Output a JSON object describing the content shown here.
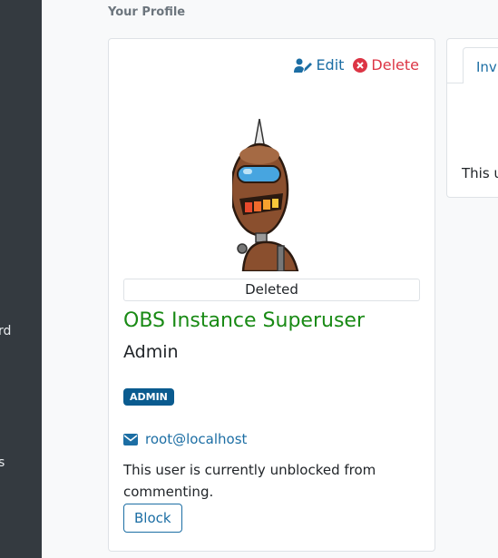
{
  "sidebar": {
    "text_top": "rd",
    "text_bottom": "s"
  },
  "breadcrumb": "Your Profile",
  "profile": {
    "edit_label": "Edit",
    "delete_label": "Delete",
    "status": "Deleted",
    "realname": "OBS Instance Superuser",
    "login": "Admin",
    "badge": "ADMIN",
    "email": "root@localhost",
    "block_text": "This user is currently unblocked from commenting.",
    "block_button": "Block"
  },
  "side_card": {
    "tab_label": "Inv",
    "text": "This u"
  },
  "colors": {
    "accent": "#1c6ea4",
    "danger": "#dc3545",
    "name": "#198a15",
    "badge": "#0a5b8f",
    "sidebar": "#343a40"
  }
}
